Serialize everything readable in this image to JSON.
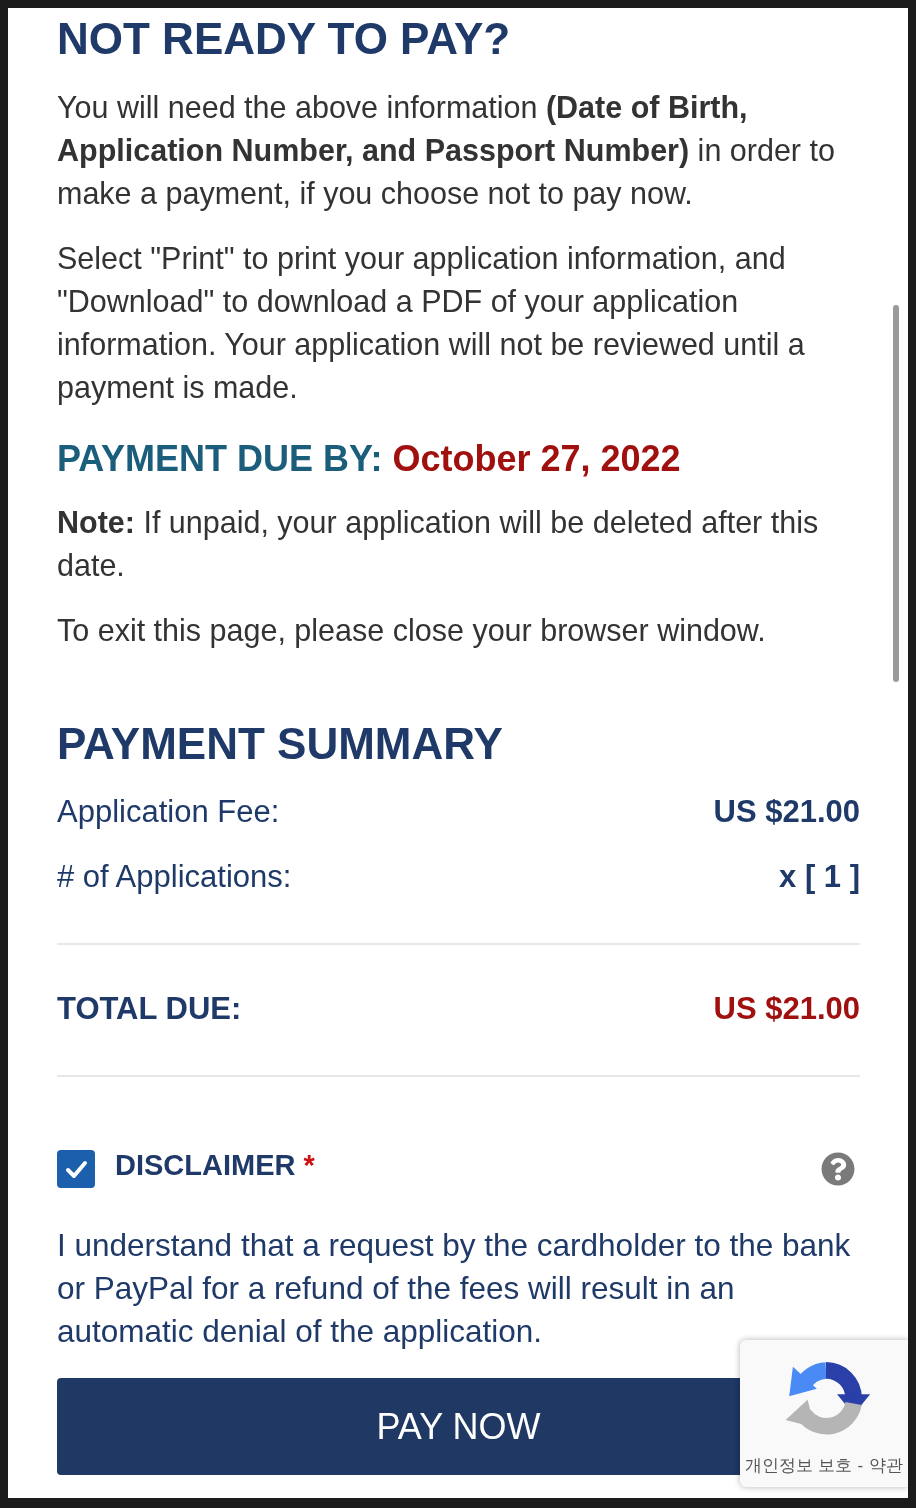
{
  "not_ready": {
    "title": "NOT READY TO PAY?",
    "paragraphs": [
      "You will need the above information **(Date of Birth, Application Number, and Passport Number)** in order to make a payment, if you choose not to pay now.",
      "Select \"Print\" to print your application information, and \"Download\" to download a PDF of your application information. Your application will not be reviewed until a payment is made."
    ]
  },
  "payment_due": {
    "label": "PAYMENT DUE BY:",
    "date": "October 27, 2022"
  },
  "note": "**Note:** If unpaid, your application will be deleted after this date.",
  "exit_text": "To exit this page, please close your browser window.",
  "payment_summary": {
    "title": "PAYMENT SUMMARY",
    "rows": [
      {
        "label": "Application Fee:",
        "value": "US $21.00"
      },
      {
        "label": "# of Applications:",
        "value": "x [ 1 ]"
      }
    ],
    "total": {
      "label": "TOTAL DUE:",
      "value": "US $21.00"
    }
  },
  "disclaimer": {
    "checked": true,
    "title": "DISCLAIMER",
    "required_mark": "*",
    "text": "I understand that a request by the cardholder to the bank or PayPal for a refund of the fees will result in an automatic denial of the application."
  },
  "pay_button": "PAY NOW",
  "recaptcha": {
    "privacy_link": "개인정보 보호",
    "separator": "-",
    "terms_link": "약관"
  }
}
